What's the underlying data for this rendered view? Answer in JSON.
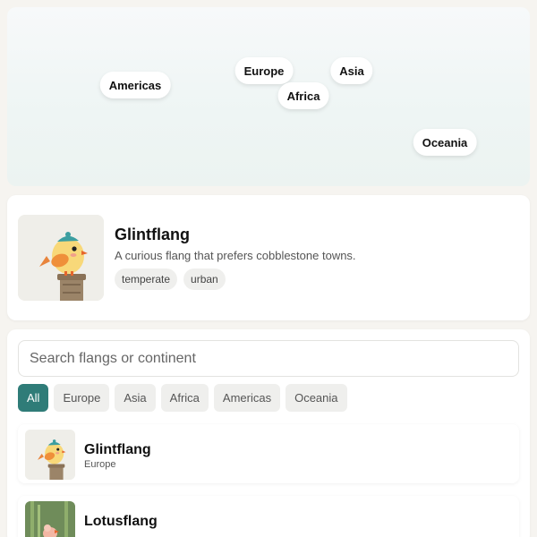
{
  "map": {
    "pins": [
      {
        "label": "Americas"
      },
      {
        "label": "Europe"
      },
      {
        "label": "Asia"
      },
      {
        "label": "Africa"
      },
      {
        "label": "Oceania"
      }
    ]
  },
  "detail": {
    "name": "Glintflang",
    "description": "A curious flang that prefers cobblestone towns.",
    "tags": [
      "temperate",
      "urban"
    ],
    "image_icon": "bird-on-pillar-icon"
  },
  "search": {
    "placeholder": "Search flangs or continent",
    "value": ""
  },
  "filters": {
    "chips": [
      "All",
      "Europe",
      "Asia",
      "Africa",
      "Americas",
      "Oceania"
    ],
    "active": "All"
  },
  "list": [
    {
      "name": "Glintflang",
      "region": "Europe",
      "image_icon": "bird-on-pillar-icon"
    },
    {
      "name": "Lotusflang",
      "region": "",
      "image_icon": "bird-with-lotus-icon"
    }
  ],
  "colors": {
    "accent": "#2f7c78",
    "background": "#f6f4f0"
  }
}
